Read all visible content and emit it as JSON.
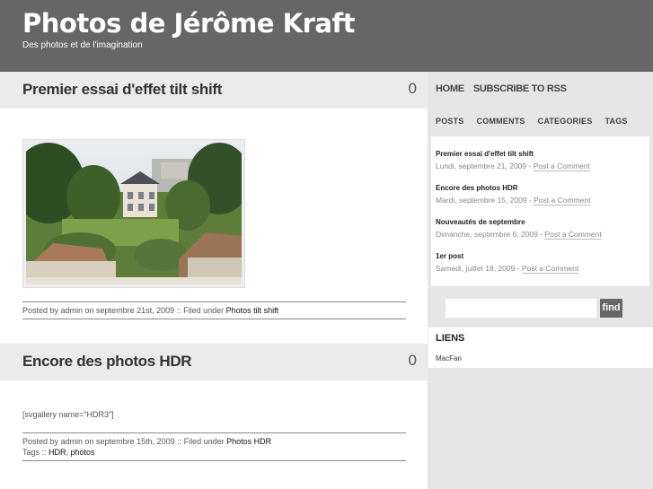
{
  "site": {
    "title": "Photos de Jérôme Kraft",
    "tagline": "Des photos et de l'imagination"
  },
  "posts": [
    {
      "title": "Premier essai d'effet tilt shift",
      "count": "0",
      "meta_prefix": "Posted by admin on septembre 21st, 2009 :: Filed under ",
      "category": "Photos tilt shift"
    },
    {
      "title": "Encore des photos HDR",
      "count": "0",
      "shortcode": "[svgallery name=\"HDR3\"]",
      "meta_prefix": "Posted by admin on septembre 15th, 2009 :: Filed under ",
      "category": "Photos HDR",
      "tags_prefix": "Tags :: ",
      "tag1": "HDR",
      "tag_sep": ", ",
      "tag2": "photos"
    }
  ],
  "nav": {
    "home": "HOME",
    "subscribe": "SUBSCRIBE TO RSS"
  },
  "tabs": {
    "posts": "POSTS",
    "comments": "COMMENTS",
    "categories": "CATEGORIES",
    "tags": "TAGS"
  },
  "recent": [
    {
      "title": "Premier essai d'effet tilt shift",
      "date": "Lundi, septembre 21, 2009 - ",
      "comment": "Post a Comment"
    },
    {
      "title": "Encore des photos HDR",
      "date": "Mardi, septembre 15, 2009 - ",
      "comment": "Post a Comment"
    },
    {
      "title": "Nouveautés de septembre",
      "date": "Dimanche, septembre 6, 2009 - ",
      "comment": "Post a Comment"
    },
    {
      "title": "1er post",
      "date": "Samedi, juillet 18, 2009 - ",
      "comment": "Post a Comment"
    }
  ],
  "search": {
    "button": "find",
    "value": ""
  },
  "links": {
    "heading": "LIENS",
    "item": "MacFan"
  }
}
